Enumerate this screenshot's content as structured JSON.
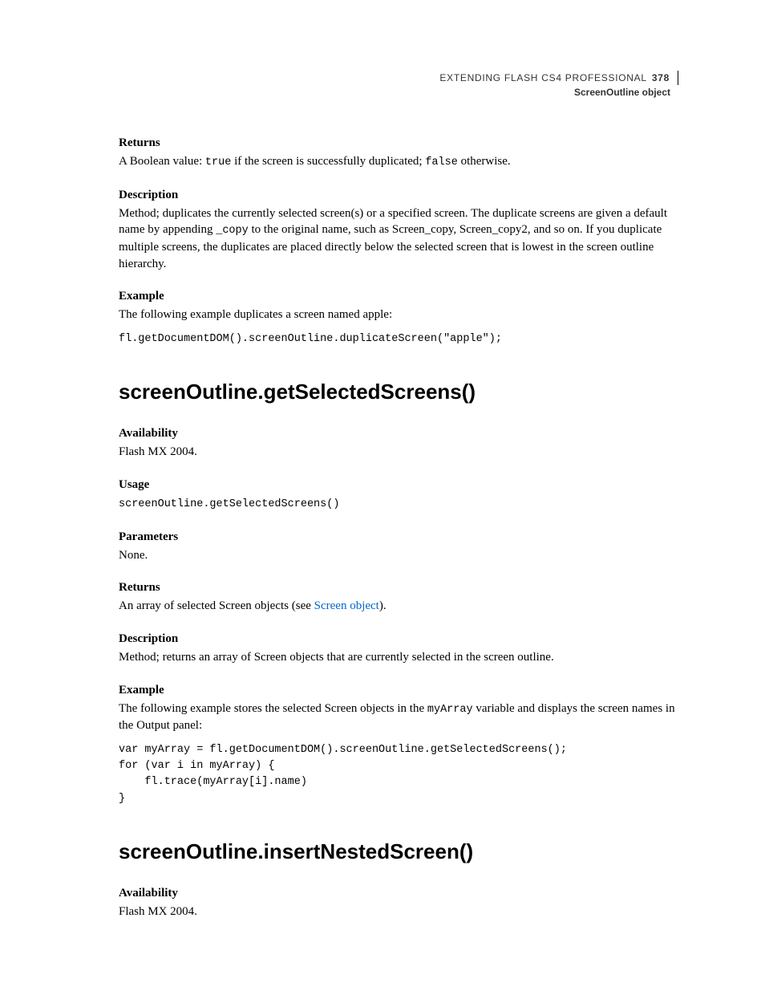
{
  "header": {
    "doc_title": "EXTENDING FLASH CS4 PROFESSIONAL",
    "page_number": "378",
    "chapter": "ScreenOutline object"
  },
  "sec1": {
    "returns_h": "Returns",
    "returns_pre": "A Boolean value: ",
    "returns_code1": "true",
    "returns_mid": " if the screen is successfully duplicated; ",
    "returns_code2": "false",
    "returns_post": " otherwise.",
    "desc_h": "Description",
    "desc_pre": "Method; duplicates the currently selected screen(s) or a specified screen. The duplicate screens are given a default name by appending ",
    "desc_code": "_copy",
    "desc_post": " to the original name, such as Screen_copy, Screen_copy2, and so on. If you duplicate multiple screens, the duplicates are placed directly below the selected screen that is lowest in the screen outline hierarchy.",
    "example_h": "Example",
    "example_intro": "The following example duplicates a screen named apple:",
    "example_code": "fl.getDocumentDOM().screenOutline.duplicateScreen(\"apple\");"
  },
  "sec2": {
    "title": "screenOutline.getSelectedScreens()",
    "avail_h": "Availability",
    "avail_body": "Flash MX 2004.",
    "usage_h": "Usage",
    "usage_code": "screenOutline.getSelectedScreens()",
    "params_h": "Parameters",
    "params_body": "None.",
    "returns_h": "Returns",
    "returns_pre": "An array of selected Screen objects (see ",
    "returns_link": "Screen object",
    "returns_post": ").",
    "desc_h": "Description",
    "desc_body": "Method; returns an array of Screen objects that are currently selected in the screen outline.",
    "example_h": "Example",
    "example_intro_pre": "The following example stores the selected Screen objects in the ",
    "example_intro_code": "myArray",
    "example_intro_post": " variable and displays the screen names in the Output panel:",
    "example_code": "var myArray = fl.getDocumentDOM().screenOutline.getSelectedScreens();\nfor (var i in myArray) {\n    fl.trace(myArray[i].name)\n}"
  },
  "sec3": {
    "title": "screenOutline.insertNestedScreen()",
    "avail_h": "Availability",
    "avail_body": "Flash MX 2004."
  }
}
